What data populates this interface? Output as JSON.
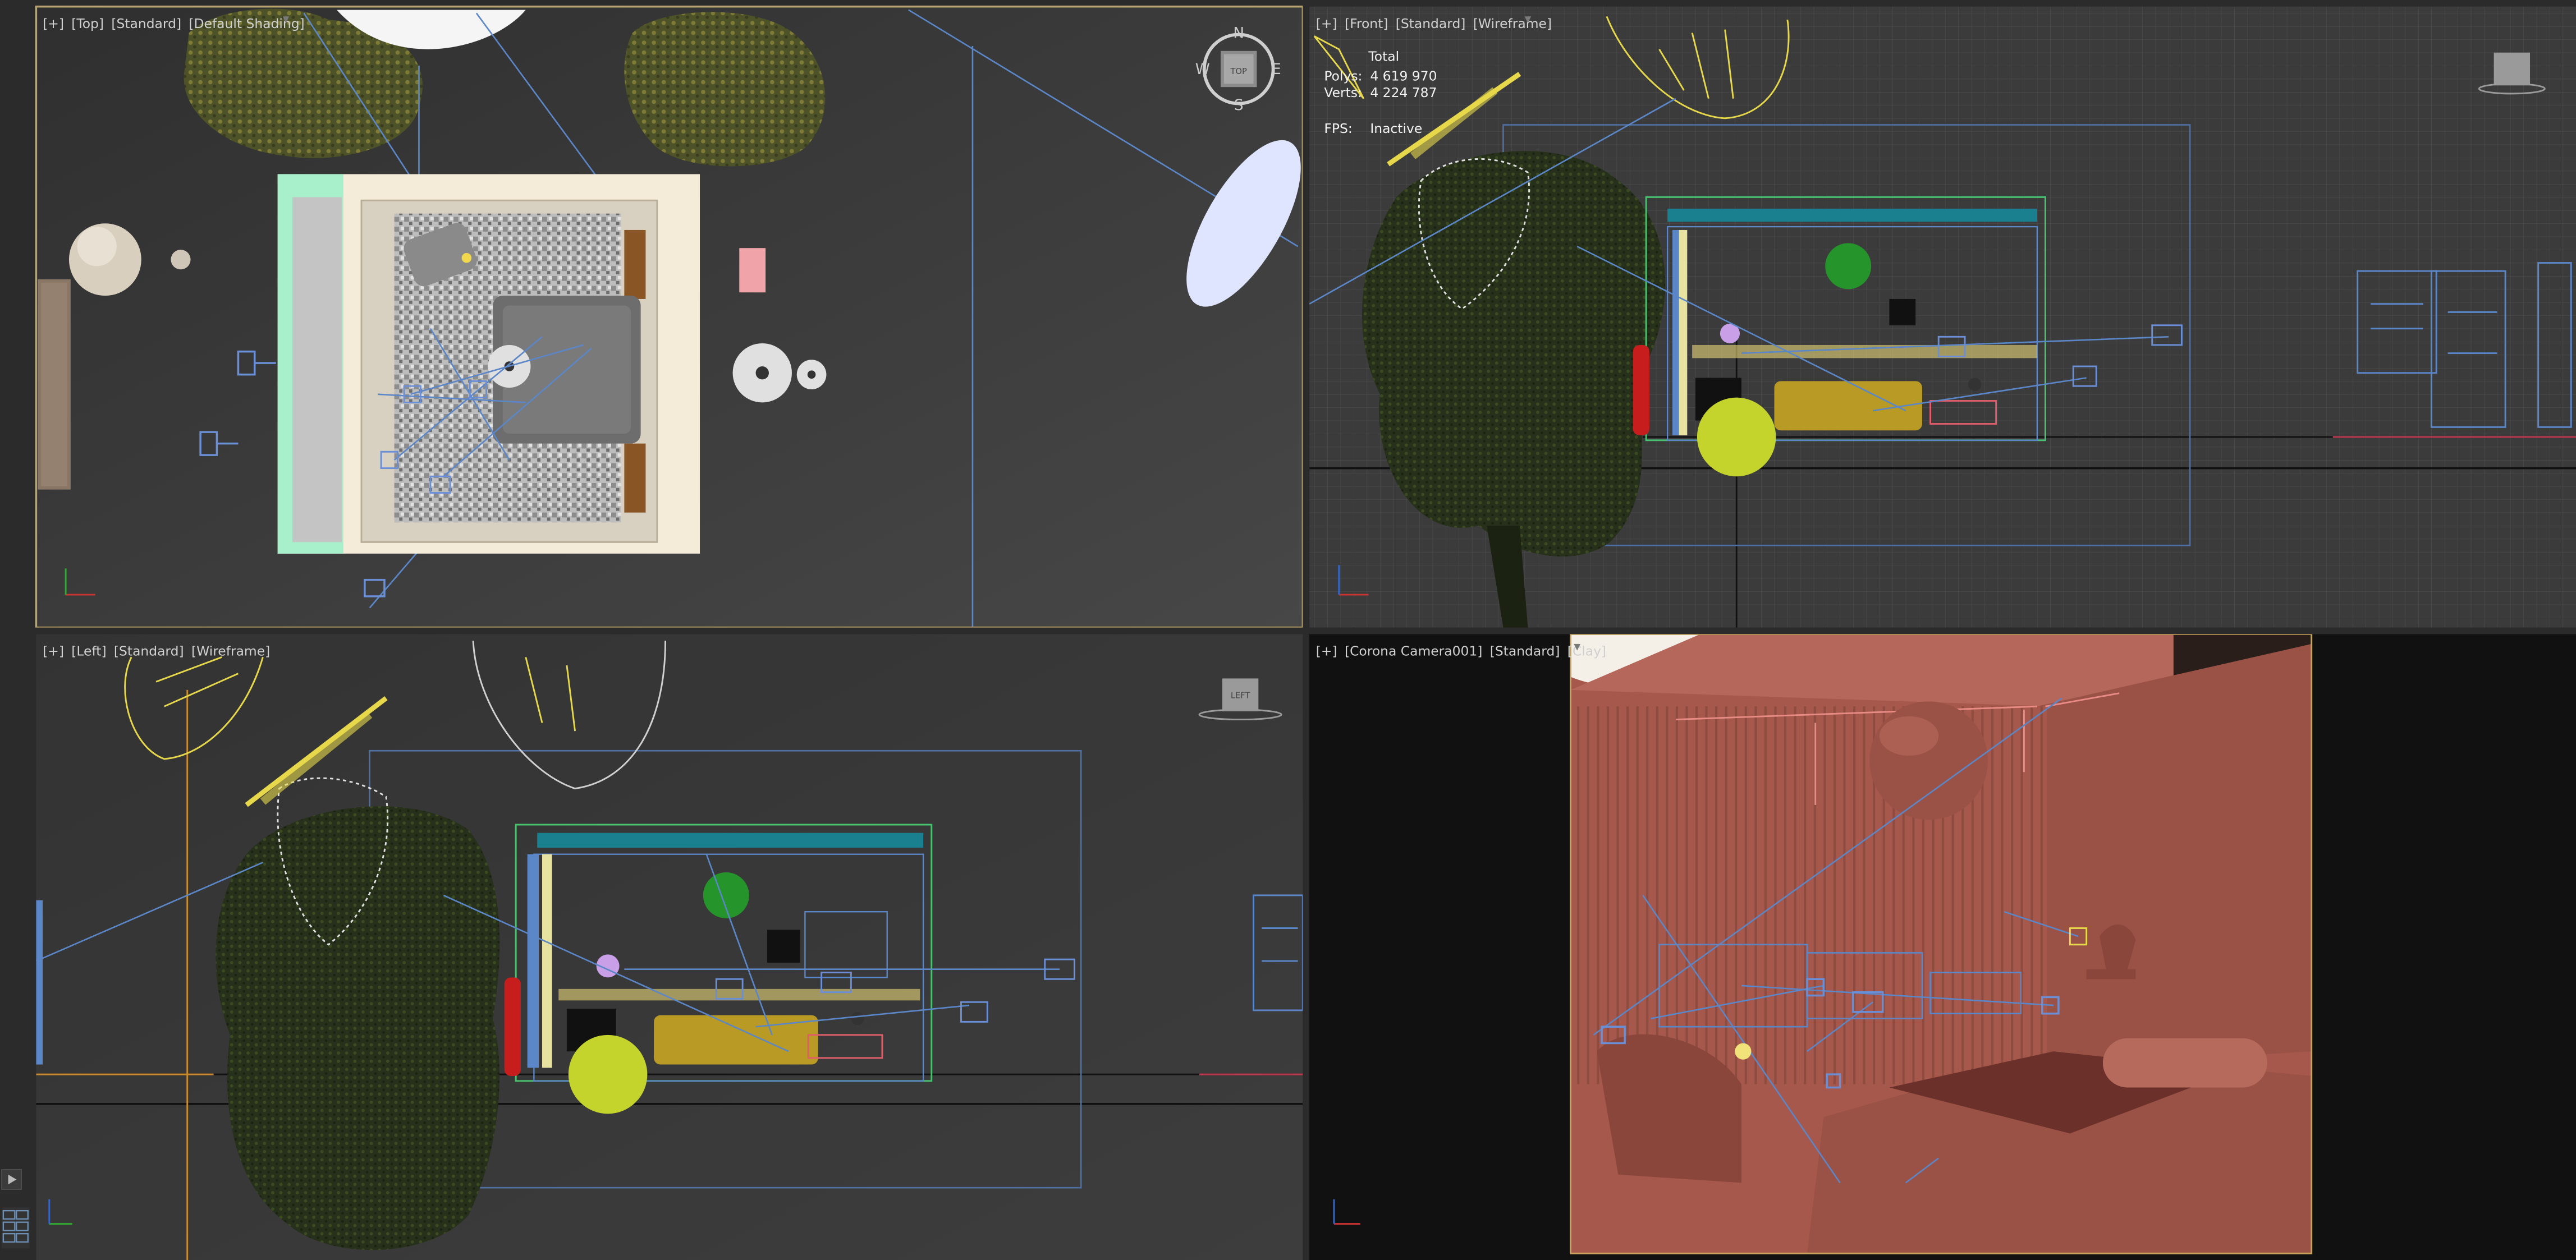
{
  "viewports": {
    "top": {
      "menu_plus": "[+]",
      "view": "[Top]",
      "mode": "[Standard]",
      "shading": "[Default Shading]"
    },
    "front": {
      "menu_plus": "[+]",
      "view": "[Front]",
      "mode": "[Standard]",
      "shading": "[Wireframe]"
    },
    "left": {
      "menu_plus": "[+]",
      "view": "[Left]",
      "mode": "[Standard]",
      "shading": "[Wireframe]"
    },
    "camera": {
      "menu_plus": "[+]",
      "view": "[Corona Camera001]",
      "mode": "[Standard]",
      "shading": "[Clay]"
    }
  },
  "stats": {
    "total_label": "Total",
    "polys_label": "Polys:",
    "polys_value": "4 619 970",
    "verts_label": "Verts:",
    "verts_value": "4 224 787",
    "fps_label": "FPS:",
    "fps_value": "Inactive"
  },
  "viewcube": {
    "top_face": "TOP",
    "left_face": "LEFT",
    "compass_n": "N",
    "compass_s": "S",
    "compass_e": "E",
    "compass_w": "W"
  },
  "colors": {
    "active_border": "#b7a46a",
    "viewport_bg": "#3a3a3a",
    "wire_blue": "#5b86c8",
    "light_yellow": "#e6d84a",
    "clay": "#a5584b"
  }
}
